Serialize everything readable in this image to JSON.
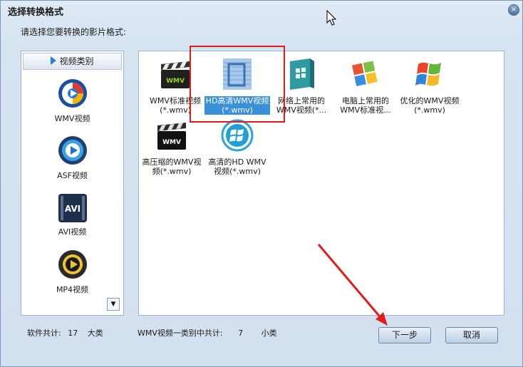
{
  "window": {
    "title": "选择转换格式",
    "close_label": "×"
  },
  "prompt": "请选择您要转换的影片格式:",
  "sidebar": {
    "header": "视频类别",
    "items": [
      {
        "label": "WMV视频",
        "icon": "wmv-disc-icon"
      },
      {
        "label": "ASF视频",
        "icon": "asf-disc-icon"
      },
      {
        "label": "AVI视频",
        "icon": "avi-icon"
      },
      {
        "label": "MP4视频",
        "icon": "mp4-disc-icon"
      }
    ],
    "scroll_glyph": "▼"
  },
  "formats": [
    {
      "line1": "WMV标准视频",
      "line2": "(*.wmv)",
      "icon": "clapperboard-icon",
      "selected": false
    },
    {
      "line1": "HD高清WMV视频",
      "line2": "(*.wmv)",
      "icon": "hd-screen-icon",
      "selected": true
    },
    {
      "line1": "网络上常用的",
      "line2": "WMV视频(*...",
      "icon": "windows-box-icon",
      "selected": false
    },
    {
      "line1": "电脑上常用的",
      "line2": "WMV标准视...",
      "icon": "windows-logo-icon",
      "selected": false
    },
    {
      "line1": "优化的WMV视频",
      "line2": "(*.wmv)",
      "icon": "windows-flag-icon",
      "selected": false
    },
    {
      "line1": "高压缩的WMV视",
      "line2": "频(*.wmv)",
      "icon": "clapperboard-dark-icon",
      "selected": false
    },
    {
      "line1": "高清的HD WMV",
      "line2": "视频(*.wmv)",
      "icon": "windows-circle-icon",
      "selected": false
    }
  ],
  "footer": {
    "software_label": "软件共计:",
    "software_count": "17",
    "software_unit": "大类",
    "category_label": "WMV视频一类别中共计:",
    "category_count": "7",
    "category_unit": "小类"
  },
  "buttons": {
    "next": "下一步",
    "cancel": "取消"
  },
  "colors": {
    "highlight_box": "#e21b1b",
    "selection": "#3a8fd9",
    "window_bg": "#d6e3f1"
  }
}
